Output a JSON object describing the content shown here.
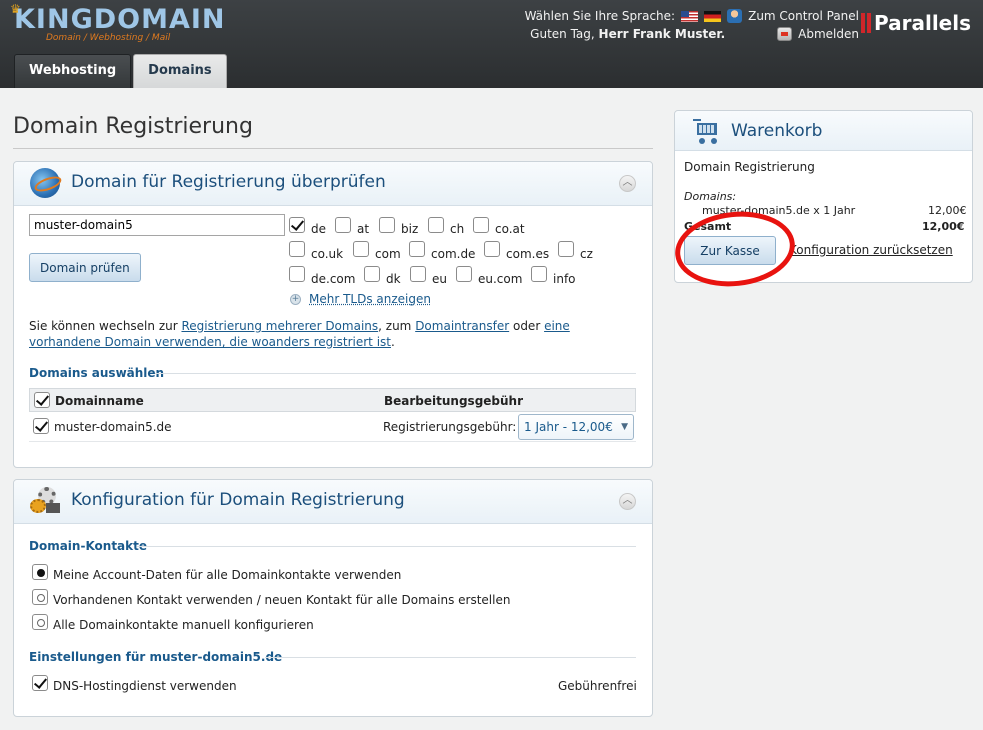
{
  "header": {
    "logo_text": "KINGDOMAIN",
    "logo_subtitle": "Domain / Webhosting / Mail",
    "language_label": "Wählen Sie Ihre Sprache:",
    "control_panel_label": "Zum Control Panel",
    "greeting_prefix": "Guten Tag,",
    "greeting_name": "Herr Frank Muster.",
    "logout_label": "Abmelden",
    "brand": "Parallels"
  },
  "tabs": [
    {
      "label": "Webhosting",
      "active": false
    },
    {
      "label": "Domains",
      "active": true
    }
  ],
  "page_title": "Domain Registrierung",
  "check_panel": {
    "title": "Domain für Registrierung überprüfen",
    "domain_input_value": "muster-domain5",
    "check_button": "Domain prüfen",
    "tlds": [
      {
        "label": "de",
        "checked": true
      },
      {
        "label": "at",
        "checked": false
      },
      {
        "label": "biz",
        "checked": false
      },
      {
        "label": "ch",
        "checked": false
      },
      {
        "label": "co.at",
        "checked": false
      },
      {
        "label": "co.uk",
        "checked": false
      },
      {
        "label": "com",
        "checked": false
      },
      {
        "label": "com.de",
        "checked": false
      },
      {
        "label": "com.es",
        "checked": false
      },
      {
        "label": "cz",
        "checked": false
      },
      {
        "label": "de.com",
        "checked": false
      },
      {
        "label": "dk",
        "checked": false
      },
      {
        "label": "eu",
        "checked": false
      },
      {
        "label": "eu.com",
        "checked": false
      },
      {
        "label": "info",
        "checked": false
      }
    ],
    "more_tlds": "Mehr TLDs anzeigen",
    "para": {
      "t1": "Sie können wechseln zur ",
      "l1": "Registrierung mehrerer Domains",
      "t2": ", zum ",
      "l2": "Domaintransfer",
      "t3": " oder ",
      "l3": "eine vorhandene Domain verwenden, die woanders registriert ist",
      "t4": "."
    },
    "select_section": "Domains auswählen",
    "col_name": "Domainname",
    "col_fee": "Bearbeitungsgebühr",
    "row": {
      "domain": "muster-domain5.de",
      "fee_label": "Registrierungsgebühr:",
      "period": "1 Jahr - 12,00€"
    }
  },
  "config_panel": {
    "title": "Konfiguration für Domain Registrierung",
    "contacts_section": "Domain-Kontakte",
    "options": [
      {
        "label": "Meine Account-Daten für alle Domainkontakte verwenden",
        "checked": true
      },
      {
        "label": "Vorhandenen Kontakt verwenden / neuen Kontakt für alle Domains erstellen",
        "checked": false
      },
      {
        "label": "Alle Domainkontakte manuell konfigurieren",
        "checked": false
      }
    ],
    "settings_section": "Einstellungen für muster-domain5.de",
    "dns_label": "DNS-Hostingdienst verwenden",
    "dns_fee": "Gebührenfrei"
  },
  "cart": {
    "title": "Warenkorb",
    "subtitle": "Domain Registrierung",
    "domains_label": "Domains:",
    "item": "muster-domain5.de x 1 Jahr",
    "item_price": "12,00€",
    "total_label": "Gesamt",
    "total_price": "12,00€",
    "checkout_button": "Zur Kasse",
    "reset_link": "Konfiguration zurücksetzen"
  },
  "colors": {
    "annotation_circle": "#e8130f",
    "link": "#1a5a8c",
    "header_bg": "#2b2e30"
  }
}
